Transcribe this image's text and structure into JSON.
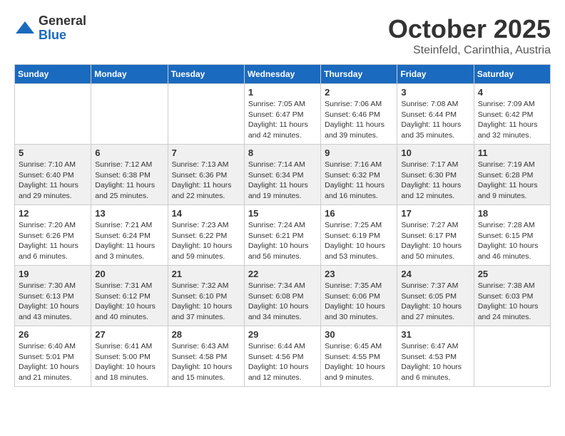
{
  "logo": {
    "general": "General",
    "blue": "Blue"
  },
  "title": "October 2025",
  "subtitle": "Steinfeld, Carinthia, Austria",
  "weekdays": [
    "Sunday",
    "Monday",
    "Tuesday",
    "Wednesday",
    "Thursday",
    "Friday",
    "Saturday"
  ],
  "weeks": [
    [
      {
        "day": "",
        "info": ""
      },
      {
        "day": "",
        "info": ""
      },
      {
        "day": "",
        "info": ""
      },
      {
        "day": "1",
        "info": "Sunrise: 7:05 AM\nSunset: 6:47 PM\nDaylight: 11 hours and 42 minutes."
      },
      {
        "day": "2",
        "info": "Sunrise: 7:06 AM\nSunset: 6:46 PM\nDaylight: 11 hours and 39 minutes."
      },
      {
        "day": "3",
        "info": "Sunrise: 7:08 AM\nSunset: 6:44 PM\nDaylight: 11 hours and 35 minutes."
      },
      {
        "day": "4",
        "info": "Sunrise: 7:09 AM\nSunset: 6:42 PM\nDaylight: 11 hours and 32 minutes."
      }
    ],
    [
      {
        "day": "5",
        "info": "Sunrise: 7:10 AM\nSunset: 6:40 PM\nDaylight: 11 hours and 29 minutes."
      },
      {
        "day": "6",
        "info": "Sunrise: 7:12 AM\nSunset: 6:38 PM\nDaylight: 11 hours and 25 minutes."
      },
      {
        "day": "7",
        "info": "Sunrise: 7:13 AM\nSunset: 6:36 PM\nDaylight: 11 hours and 22 minutes."
      },
      {
        "day": "8",
        "info": "Sunrise: 7:14 AM\nSunset: 6:34 PM\nDaylight: 11 hours and 19 minutes."
      },
      {
        "day": "9",
        "info": "Sunrise: 7:16 AM\nSunset: 6:32 PM\nDaylight: 11 hours and 16 minutes."
      },
      {
        "day": "10",
        "info": "Sunrise: 7:17 AM\nSunset: 6:30 PM\nDaylight: 11 hours and 12 minutes."
      },
      {
        "day": "11",
        "info": "Sunrise: 7:19 AM\nSunset: 6:28 PM\nDaylight: 11 hours and 9 minutes."
      }
    ],
    [
      {
        "day": "12",
        "info": "Sunrise: 7:20 AM\nSunset: 6:26 PM\nDaylight: 11 hours and 6 minutes."
      },
      {
        "day": "13",
        "info": "Sunrise: 7:21 AM\nSunset: 6:24 PM\nDaylight: 11 hours and 3 minutes."
      },
      {
        "day": "14",
        "info": "Sunrise: 7:23 AM\nSunset: 6:22 PM\nDaylight: 10 hours and 59 minutes."
      },
      {
        "day": "15",
        "info": "Sunrise: 7:24 AM\nSunset: 6:21 PM\nDaylight: 10 hours and 56 minutes."
      },
      {
        "day": "16",
        "info": "Sunrise: 7:25 AM\nSunset: 6:19 PM\nDaylight: 10 hours and 53 minutes."
      },
      {
        "day": "17",
        "info": "Sunrise: 7:27 AM\nSunset: 6:17 PM\nDaylight: 10 hours and 50 minutes."
      },
      {
        "day": "18",
        "info": "Sunrise: 7:28 AM\nSunset: 6:15 PM\nDaylight: 10 hours and 46 minutes."
      }
    ],
    [
      {
        "day": "19",
        "info": "Sunrise: 7:30 AM\nSunset: 6:13 PM\nDaylight: 10 hours and 43 minutes."
      },
      {
        "day": "20",
        "info": "Sunrise: 7:31 AM\nSunset: 6:12 PM\nDaylight: 10 hours and 40 minutes."
      },
      {
        "day": "21",
        "info": "Sunrise: 7:32 AM\nSunset: 6:10 PM\nDaylight: 10 hours and 37 minutes."
      },
      {
        "day": "22",
        "info": "Sunrise: 7:34 AM\nSunset: 6:08 PM\nDaylight: 10 hours and 34 minutes."
      },
      {
        "day": "23",
        "info": "Sunrise: 7:35 AM\nSunset: 6:06 PM\nDaylight: 10 hours and 30 minutes."
      },
      {
        "day": "24",
        "info": "Sunrise: 7:37 AM\nSunset: 6:05 PM\nDaylight: 10 hours and 27 minutes."
      },
      {
        "day": "25",
        "info": "Sunrise: 7:38 AM\nSunset: 6:03 PM\nDaylight: 10 hours and 24 minutes."
      }
    ],
    [
      {
        "day": "26",
        "info": "Sunrise: 6:40 AM\nSunset: 5:01 PM\nDaylight: 10 hours and 21 minutes."
      },
      {
        "day": "27",
        "info": "Sunrise: 6:41 AM\nSunset: 5:00 PM\nDaylight: 10 hours and 18 minutes."
      },
      {
        "day": "28",
        "info": "Sunrise: 6:43 AM\nSunset: 4:58 PM\nDaylight: 10 hours and 15 minutes."
      },
      {
        "day": "29",
        "info": "Sunrise: 6:44 AM\nSunset: 4:56 PM\nDaylight: 10 hours and 12 minutes."
      },
      {
        "day": "30",
        "info": "Sunrise: 6:45 AM\nSunset: 4:55 PM\nDaylight: 10 hours and 9 minutes."
      },
      {
        "day": "31",
        "info": "Sunrise: 6:47 AM\nSunset: 4:53 PM\nDaylight: 10 hours and 6 minutes."
      },
      {
        "day": "",
        "info": ""
      }
    ]
  ]
}
